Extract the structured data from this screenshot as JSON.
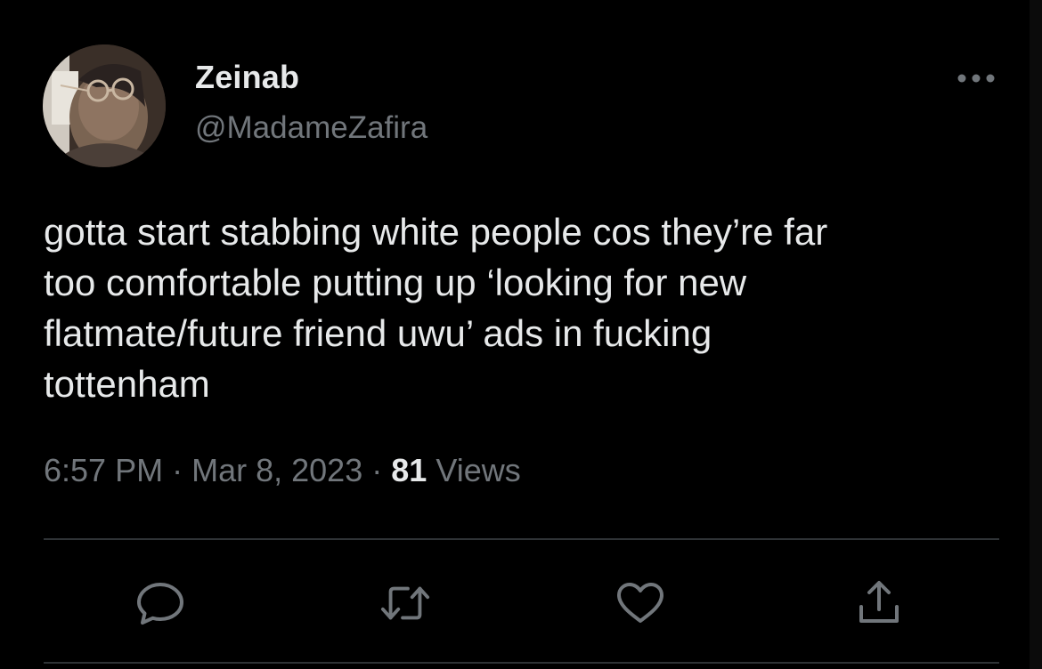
{
  "author": {
    "display_name": "Zeinab",
    "handle": "@MadameZafira",
    "avatar_icon": "profile-photo"
  },
  "tweet": {
    "text": "gotta start stabbing white people cos they’re far\ntoo comfortable putting up ‘looking for new\nflatmate/future friend uwu’ ads in fucking\ntottenham",
    "time": "6:57 PM",
    "date": "Mar 8, 2023",
    "separator": "·",
    "views_count": "81",
    "views_label": "Views"
  },
  "actions": [
    {
      "name": "reply",
      "icon": "speech-bubble-icon"
    },
    {
      "name": "retweet",
      "icon": "retweet-icon"
    },
    {
      "name": "like",
      "icon": "heart-icon"
    },
    {
      "name": "share",
      "icon": "share-icon"
    }
  ],
  "more_menu_icon": "ellipsis-icon",
  "colors": {
    "background": "#000000",
    "primary_text": "#e7e9ea",
    "secondary_text": "#71767b",
    "divider": "#2f3336"
  }
}
